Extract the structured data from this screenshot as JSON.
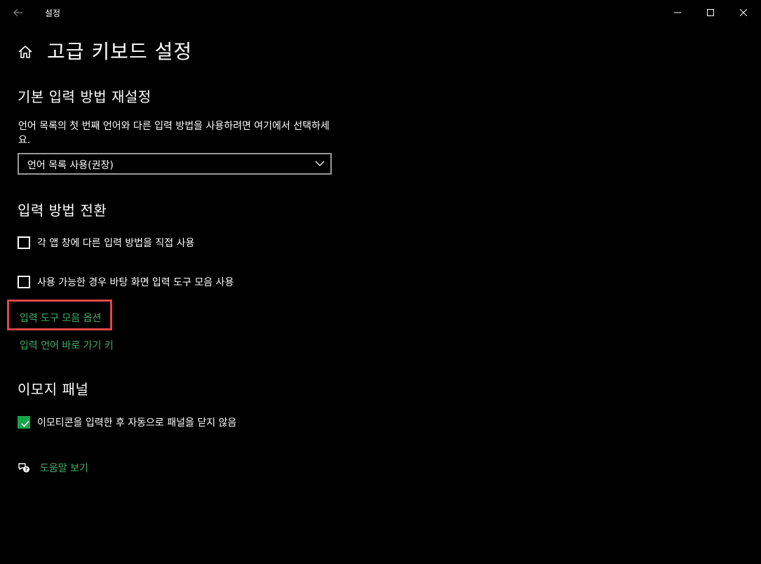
{
  "window": {
    "title": "설정"
  },
  "header": {
    "page_title": "고급 키보드 설정"
  },
  "default_input": {
    "section_title": "기본 입력 방법 재설정",
    "description": "언어 목록의 첫 번째 언어와 다른 입력 방법을 사용하려면 여기에서 선택하세요.",
    "dropdown_value": "언어 목록 사용(권장)"
  },
  "switching": {
    "section_title": "입력 방법 전환",
    "checkbox_per_app": "각 앱 창에 다른 입력 방법을 직접 사용",
    "checkbox_per_app_checked": false,
    "checkbox_langbar": "사용 가능한 경우 바탕 화면 입력 도구 모음 사용",
    "checkbox_langbar_checked": false,
    "link_toolbar_options": "입력 도구 모음 옵션",
    "link_hotkeys": "입력 언어 바로 가기 키"
  },
  "emoji": {
    "section_title": "이모지 패널",
    "checkbox_keep_open": "이모티콘을 입력한 후 자동으로 패널을 닫지 않음",
    "checkbox_keep_open_checked": true
  },
  "help": {
    "label": "도움말 보기"
  },
  "colors": {
    "background": "#000000",
    "link": "#3fae6a",
    "accent": "#16a34a",
    "highlight": "#e04848"
  }
}
